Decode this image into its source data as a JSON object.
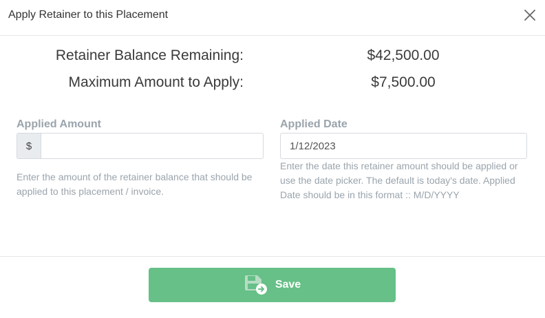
{
  "dialog": {
    "title": "Apply Retainer to this Placement",
    "close_icon": "close-icon"
  },
  "summary": {
    "balance_label": "Retainer Balance Remaining:",
    "balance_value": "$42,500.00",
    "max_label": "Maximum Amount to Apply:",
    "max_value": "$7,500.00"
  },
  "applied_amount": {
    "label": "Applied Amount",
    "currency_symbol": "$",
    "value": "",
    "help": "Enter the amount of the retainer balance that should be applied to this placement / invoice."
  },
  "applied_date": {
    "label": "Applied Date",
    "value": "1/12/2023",
    "help": "Enter the date this retainer amount should be applied or use the date picker. The default is today's date. Applied Date should be in this format :: M/D/YYYY"
  },
  "footer": {
    "save_label": "Save",
    "save_icon": "save-disk-arrow-icon"
  },
  "colors": {
    "save_button": "#66c087",
    "label_gray": "#9aa4ac",
    "border": "#d5d9dd"
  }
}
